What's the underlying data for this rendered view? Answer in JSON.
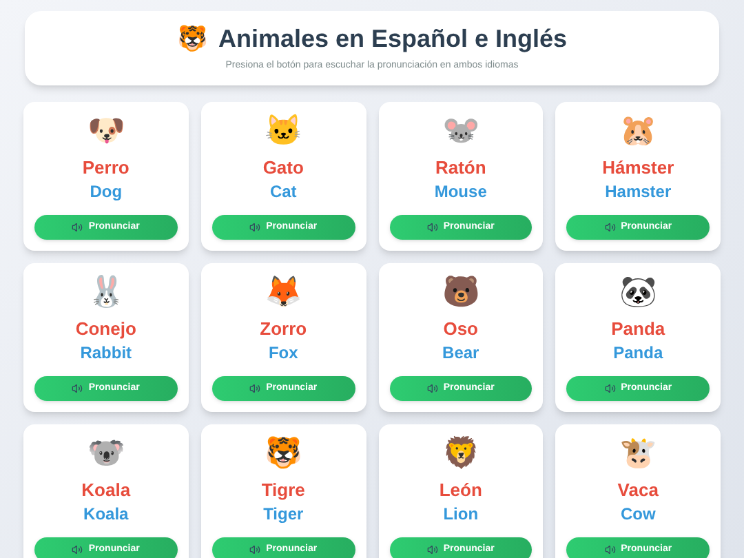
{
  "header": {
    "emoji": "🐯",
    "title": "Animales en Español e Inglés",
    "subtitle": "Presiona el botón para escuchar la pronunciación en ambos idiomas"
  },
  "cards": [
    {
      "emoji": "🐶",
      "spanish": "Perro",
      "english": "Dog",
      "button": "Pronunciar"
    },
    {
      "emoji": "🐱",
      "spanish": "Gato",
      "english": "Cat",
      "button": "Pronunciar"
    },
    {
      "emoji": "🐭",
      "spanish": "Ratón",
      "english": "Mouse",
      "button": "Pronunciar"
    },
    {
      "emoji": "🐹",
      "spanish": "Hámster",
      "english": "Hamster",
      "button": "Pronunciar"
    },
    {
      "emoji": "🐰",
      "spanish": "Conejo",
      "english": "Rabbit",
      "button": "Pronunciar"
    },
    {
      "emoji": "🦊",
      "spanish": "Zorro",
      "english": "Fox",
      "button": "Pronunciar"
    },
    {
      "emoji": "🐻",
      "spanish": "Oso",
      "english": "Bear",
      "button": "Pronunciar"
    },
    {
      "emoji": "🐼",
      "spanish": "Panda",
      "english": "Panda",
      "button": "Pronunciar"
    },
    {
      "emoji": "🐨",
      "spanish": "Koala",
      "english": "Koala",
      "button": "Pronunciar"
    },
    {
      "emoji": "🐯",
      "spanish": "Tigre",
      "english": "Tiger",
      "button": "Pronunciar"
    },
    {
      "emoji": "🦁",
      "spanish": "León",
      "english": "Lion",
      "button": "Pronunciar"
    },
    {
      "emoji": "🐮",
      "spanish": "Vaca",
      "english": "Cow",
      "button": "Pronunciar"
    }
  ]
}
